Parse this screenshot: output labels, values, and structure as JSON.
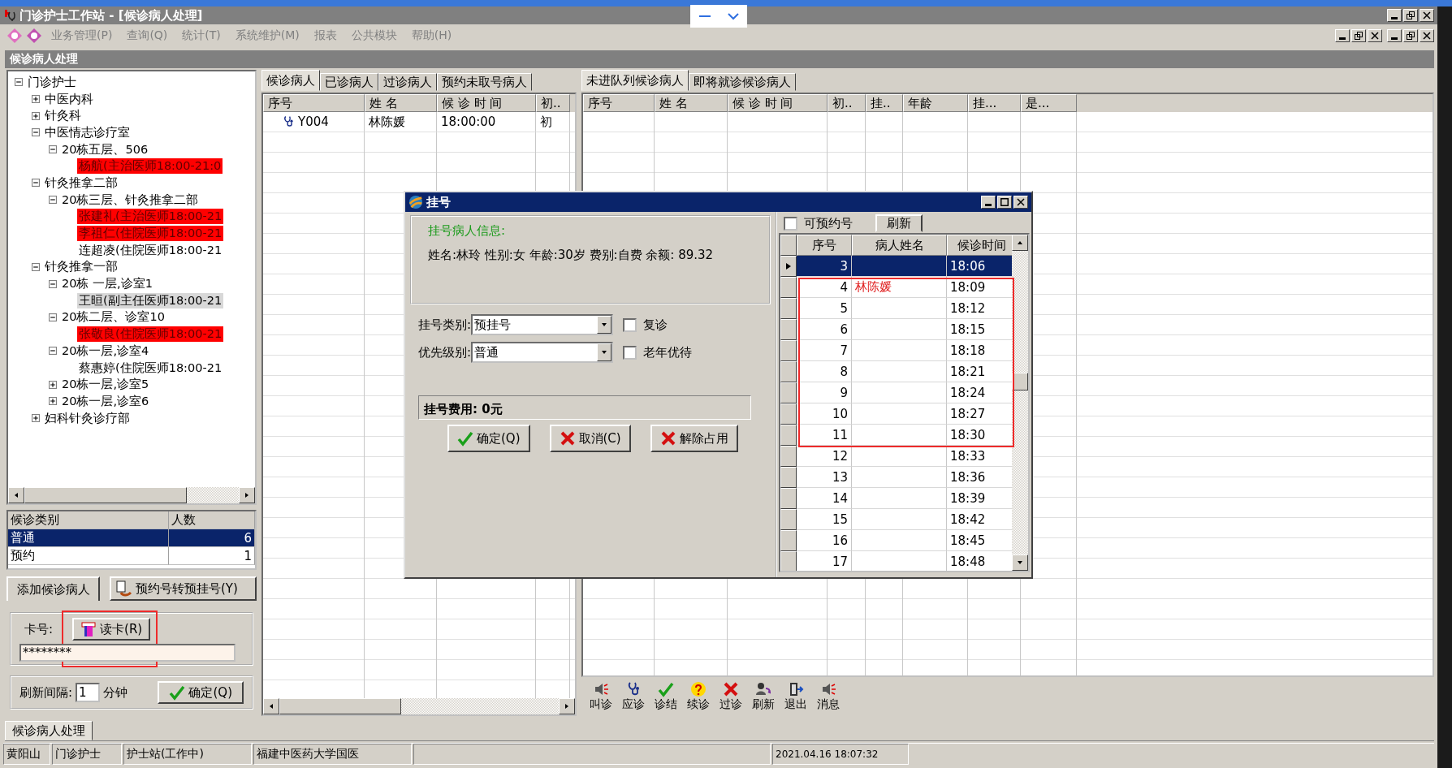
{
  "window": {
    "title": "门诊护士工作站 - [候诊病人处理]"
  },
  "menu": [
    "业务管理(P)",
    "查询(Q)",
    "统计(T)",
    "系统维护(M)",
    "报表",
    "公共模块",
    "帮助(H)"
  ],
  "child_window": {
    "title": "候诊病人处理"
  },
  "tree": {
    "label": "门诊护士",
    "expanded": true,
    "children": [
      {
        "label": "中医内科",
        "expanded": false
      },
      {
        "label": "针灸科",
        "expanded": false
      },
      {
        "label": "中医情志诊疗室",
        "expanded": true,
        "children": [
          {
            "label": "20栋五层、506",
            "expanded": true,
            "children": [
              {
                "label": "杨航(主治医师18:00-21:0",
                "highlighted": true,
                "selected": false
              }
            ]
          }
        ]
      },
      {
        "label": "针灸推拿二部",
        "expanded": true,
        "children": [
          {
            "label": "20栋三层、针灸推拿二部",
            "expanded": true,
            "children": [
              {
                "label": "张建礼(主治医师18:00-21",
                "highlighted": true,
                "selected": false
              },
              {
                "label": "李祖仁(住院医师18:00-21",
                "highlighted": true,
                "selected": false
              },
              {
                "label": "连超凌(住院医师18:00-21",
                "highlighted": false,
                "selected": false
              }
            ]
          }
        ]
      },
      {
        "label": "针灸推拿一部",
        "expanded": true,
        "children": [
          {
            "label": "20栋  一层,诊室1",
            "expanded": true,
            "children": [
              {
                "label": "王晅(副主任医师18:00-21",
                "highlighted": false,
                "selected": true
              }
            ]
          },
          {
            "label": "20栋二层、诊室10",
            "expanded": true,
            "children": [
              {
                "label": "张敬良(住院医师18:00-21",
                "highlighted": true,
                "selected": false
              }
            ]
          },
          {
            "label": "20栋一层,诊室4",
            "expanded": true,
            "children": [
              {
                "label": "蔡惠婷(住院医师18:00-21",
                "highlighted": false,
                "selected": false
              }
            ]
          },
          {
            "label": "20栋一层,诊室5",
            "expanded": false
          },
          {
            "label": "20栋一层,诊室6",
            "expanded": false
          }
        ]
      },
      {
        "label": "妇科针灸诊疗部",
        "expanded": false
      }
    ]
  },
  "categories": {
    "columns": [
      "候诊类别",
      "人数"
    ],
    "rows": [
      {
        "cells": [
          "普通",
          "6"
        ],
        "selected": true
      },
      {
        "cells": [
          "预约",
          "1"
        ],
        "selected": false
      }
    ]
  },
  "left_buttons": [
    {
      "label": "添加候诊病人",
      "kind": "plain"
    },
    {
      "label": "预约号转预挂号(Y)",
      "kind": "convert"
    }
  ],
  "card": {
    "label": "卡号:",
    "button": "读卡(R)",
    "value": "********",
    "highlighted": true
  },
  "refresh": {
    "label": "刷新间隔:",
    "value": "1",
    "unit": "分钟",
    "button": "确定(Q)"
  },
  "middle_tabs": [
    {
      "label": "候诊病人",
      "selected": true
    },
    {
      "label": "已诊病人",
      "selected": false
    },
    {
      "label": "过诊病人",
      "selected": false
    },
    {
      "label": "预约未取号病人",
      "selected": false
    }
  ],
  "middle_table": {
    "columns": [
      "序号",
      "姓  名",
      "候 诊 时 间",
      "初.."
    ],
    "rows": [
      {
        "cells": [
          "Y004",
          "林陈媛",
          "18:00:00",
          "初"
        ]
      }
    ]
  },
  "right_tabs": [
    {
      "label": "未进队列候诊病人",
      "selected": true
    },
    {
      "label": "即将就诊候诊病人",
      "selected": false
    }
  ],
  "right_table": {
    "columns": [
      "序号",
      "姓  名",
      "候 诊 时 间",
      "初..",
      "挂..",
      "年龄",
      "挂...",
      "是..."
    ]
  },
  "toolbar": [
    {
      "label": "叫诊",
      "kind": "speaker"
    },
    {
      "label": "应诊",
      "kind": "stethoscope"
    },
    {
      "label": "诊结",
      "kind": "check"
    },
    {
      "label": "续诊",
      "kind": "question"
    },
    {
      "label": "过诊",
      "kind": "cross"
    },
    {
      "label": "刷新",
      "kind": "users"
    },
    {
      "label": "退出",
      "kind": "exit"
    },
    {
      "label": "消息",
      "kind": "speaker"
    }
  ],
  "bottom_tabs": [
    {
      "label": "候诊病人处理",
      "selected": true
    }
  ],
  "status_bar": [
    "黄阳山",
    "门诊护士",
    "护士站(工作中)",
    "福建中医药大学国医",
    "2021.04.16 18:07:32"
  ],
  "dialog": {
    "title": "挂号",
    "info_heading": "挂号病人信息:",
    "info_text": "姓名:林玲  性别:女  年龄:30岁  费别:自费  余额: 89.32",
    "fields": [
      {
        "label": "挂号类别:",
        "value": "预挂号"
      },
      {
        "label": "优先级别:",
        "value": "普通"
      }
    ],
    "checkboxes": [
      {
        "label": "复诊",
        "checked": false
      },
      {
        "label": "老年优待",
        "checked": false
      }
    ],
    "fee": "挂号费用: 0元",
    "buttons": [
      {
        "label": "确定(Q)",
        "kind": "check"
      },
      {
        "label": "取消(C)",
        "kind": "cross"
      },
      {
        "label": "解除占用",
        "kind": "cross"
      }
    ],
    "bookable": {
      "label": "可预约号",
      "checked": false
    },
    "refresh_button": "刷新",
    "slots": {
      "columns": [
        "序号",
        "病人姓名",
        "候诊时间"
      ],
      "highlighted": true,
      "rows": [
        {
          "no": "3",
          "name": "",
          "time": "18:06",
          "selected": true
        },
        {
          "no": "4",
          "name": "林陈媛",
          "time": "18:09",
          "selected": false
        },
        {
          "no": "5",
          "name": "",
          "time": "18:12",
          "selected": false
        },
        {
          "no": "6",
          "name": "",
          "time": "18:15",
          "selected": false
        },
        {
          "no": "7",
          "name": "",
          "time": "18:18",
          "selected": false
        },
        {
          "no": "8",
          "name": "",
          "time": "18:21",
          "selected": false
        },
        {
          "no": "9",
          "name": "",
          "time": "18:24",
          "selected": false
        },
        {
          "no": "10",
          "name": "",
          "time": "18:27",
          "selected": false
        },
        {
          "no": "11",
          "name": "",
          "time": "18:30",
          "selected": false
        },
        {
          "no": "12",
          "name": "",
          "time": "18:33",
          "selected": false
        },
        {
          "no": "13",
          "name": "",
          "time": "18:36",
          "selected": false
        },
        {
          "no": "14",
          "name": "",
          "time": "18:39",
          "selected": false
        },
        {
          "no": "15",
          "name": "",
          "time": "18:42",
          "selected": false
        },
        {
          "no": "16",
          "name": "",
          "time": "18:45",
          "selected": false
        },
        {
          "no": "17",
          "name": "",
          "time": "18:48",
          "selected": false
        }
      ]
    }
  }
}
